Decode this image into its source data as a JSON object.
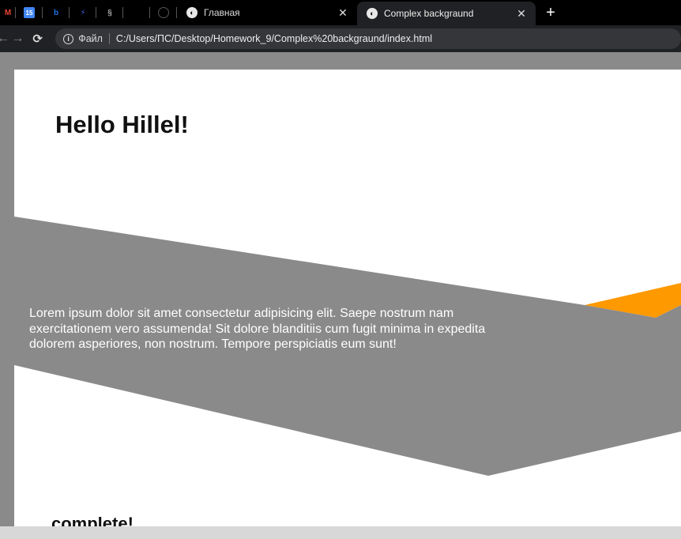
{
  "browser": {
    "pinned_tabs": [
      {
        "icon": "gmail-icon",
        "glyph": "M",
        "color": "#ea4335"
      },
      {
        "icon": "calendar-icon",
        "glyph": "15",
        "color": "#4285f4"
      },
      {
        "icon": "app-icon",
        "glyph": "b",
        "color": "#1a73e8"
      },
      {
        "icon": "lightning-icon",
        "glyph": "⚡",
        "color": "#3b5bdb"
      },
      {
        "icon": "script-icon",
        "glyph": "§",
        "color": "#aaaaaa"
      },
      {
        "icon": "blank-icon",
        "glyph": "",
        "color": "#000000"
      },
      {
        "icon": "github-icon",
        "glyph": "◯",
        "color": "#555555"
      }
    ],
    "tabs": [
      {
        "title": "Главная",
        "active": false
      },
      {
        "title": "Complex backgraund",
        "active": true
      }
    ],
    "new_tab_label": "+",
    "address": {
      "security_label": "Файл",
      "url": "C:/Users/ПС/Desktop/Homework_9/Complex%20backgraund/index.html"
    }
  },
  "page": {
    "heading": "Hello Hillel!",
    "paragraph": "Lorem ipsum dolor sit amet consectetur adipisicing elit. Saepe nostrum nam exercitationem vero assumenda! Sit dolore blanditiis cum fugit minima in expedita dolorem asperiores, non nostrum. Tempore perspiciatis eum sunt!",
    "footer_heading": "complete!"
  },
  "colors": {
    "band": "#8a8a8a",
    "accent": "#ff9900",
    "page_bg": "#ffffff",
    "chrome_dark": "#202124"
  }
}
